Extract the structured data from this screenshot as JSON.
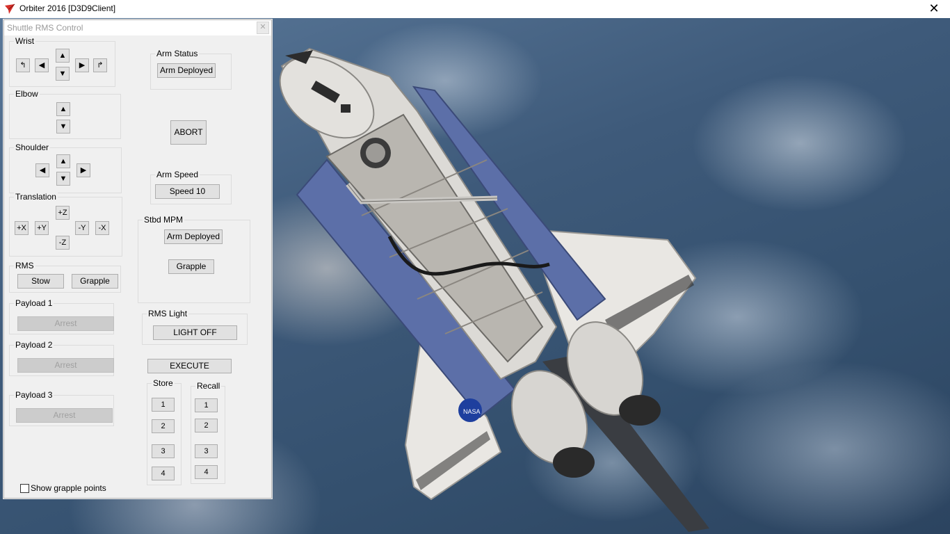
{
  "window": {
    "title": "Orbiter 2016 [D3D9Client]",
    "close": "✕"
  },
  "dialog": {
    "title": "Shuttle RMS Control",
    "close": "✕",
    "wrist": {
      "label": "Wrist",
      "roll_left": "↰",
      "left": "◀",
      "up": "▲",
      "down": "▼",
      "right": "▶",
      "roll_right": "↱"
    },
    "elbow": {
      "label": "Elbow",
      "up": "▲",
      "down": "▼"
    },
    "shoulder": {
      "label": "Shoulder",
      "left": "◀",
      "up": "▲",
      "down": "▼",
      "right": "▶"
    },
    "translation": {
      "label": "Translation",
      "plus_z": "+Z",
      "minus_z": "-Z",
      "plus_x": "+X",
      "plus_y": "+Y",
      "minus_y": "-Y",
      "minus_x": "-X"
    },
    "rms": {
      "label": "RMS",
      "stow": "Stow",
      "grapple": "Grapple"
    },
    "payload1": {
      "label": "Payload 1",
      "arrest": "Arrest"
    },
    "payload2": {
      "label": "Payload 2",
      "arrest": "Arrest"
    },
    "payload3": {
      "label": "Payload 3",
      "arrest": "Arrest"
    },
    "show_grapple_points": "Show grapple points",
    "arm_status": {
      "label": "Arm Status",
      "value": "Arm Deployed"
    },
    "abort": "ABORT",
    "arm_speed": {
      "label": "Arm Speed",
      "value": "Speed 10"
    },
    "stbd_mpm": {
      "label": "Stbd MPM",
      "deployed": "Arm Deployed",
      "grapple": "Grapple"
    },
    "rms_light": {
      "label": "RMS Light",
      "toggle": "LIGHT OFF"
    },
    "execute": "EXECUTE",
    "store": {
      "label": "Store",
      "slots": [
        "1",
        "2",
        "3",
        "4"
      ]
    },
    "recall": {
      "label": "Recall",
      "slots": [
        "1",
        "2",
        "3",
        "4"
      ]
    }
  },
  "scene": {
    "orbiter_decal": "NASA",
    "earth_color": "#3e5a7a"
  }
}
